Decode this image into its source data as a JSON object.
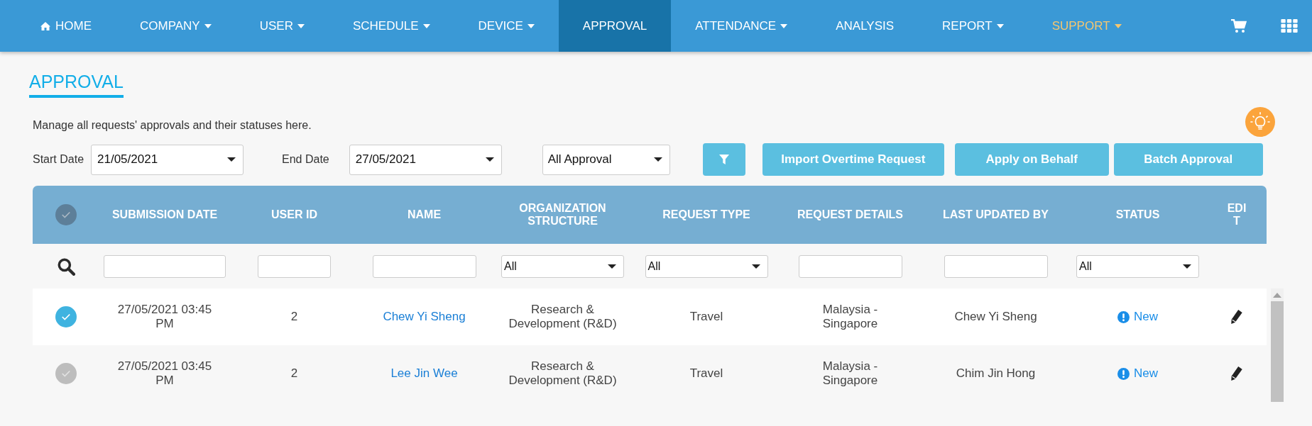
{
  "nav": {
    "items": [
      {
        "label": "HOME",
        "kind": "home",
        "selected": false,
        "highlighted": false
      },
      {
        "label": "COMPANY",
        "kind": "menu",
        "selected": false,
        "highlighted": false
      },
      {
        "label": "USER",
        "kind": "menu",
        "selected": false,
        "highlighted": false
      },
      {
        "label": "SCHEDULE",
        "kind": "menu",
        "selected": false,
        "highlighted": false
      },
      {
        "label": "DEVICE",
        "kind": "menu",
        "selected": false,
        "highlighted": false
      },
      {
        "label": "APPROVAL",
        "kind": "link",
        "selected": true,
        "highlighted": false
      },
      {
        "label": "ATTENDANCE",
        "kind": "menu",
        "selected": false,
        "highlighted": false
      },
      {
        "label": "ANALYSIS",
        "kind": "link",
        "selected": false,
        "highlighted": false
      },
      {
        "label": "REPORT",
        "kind": "menu",
        "selected": false,
        "highlighted": false
      },
      {
        "label": "SUPPORT",
        "kind": "menu",
        "selected": false,
        "highlighted": true
      }
    ]
  },
  "page": {
    "title": "APPROVAL",
    "description": "Manage all requests' approvals and their statuses here."
  },
  "filters": {
    "start_date": {
      "label": "Start Date",
      "value": "21/05/2021"
    },
    "end_date": {
      "label": "End Date",
      "value": "27/05/2021"
    },
    "approval": {
      "value": "All Approval"
    }
  },
  "buttons": [
    "Import Overtime Request",
    "Apply on Behalf",
    "Batch Approval"
  ],
  "table": {
    "select_all": {
      "checked": false
    },
    "columns": [
      {
        "label": "SUBMISSION DATE",
        "filter": {
          "kind": "text"
        }
      },
      {
        "label": "USER ID",
        "filter": {
          "kind": "text"
        }
      },
      {
        "label": "NAME",
        "filter": {
          "kind": "text"
        }
      },
      {
        "label": "ORGANIZATION STRUCTURE",
        "filter": {
          "kind": "select",
          "value": "All"
        }
      },
      {
        "label": "REQUEST TYPE",
        "filter": {
          "kind": "select",
          "value": "All"
        }
      },
      {
        "label": "REQUEST DETAILS",
        "filter": {
          "kind": "text"
        }
      },
      {
        "label": "LAST UPDATED BY",
        "filter": {
          "kind": "text"
        }
      },
      {
        "label": "STATUS",
        "filter": {
          "kind": "select",
          "value": "All"
        }
      },
      {
        "label": "EDI T",
        "filter": {
          "kind": "none"
        }
      }
    ],
    "rows": [
      {
        "selected": true,
        "submission_date": "27/05/2021 03:45 PM",
        "user_id": "2",
        "name": "Chew Yi Sheng",
        "organization": "Research & Development (R&D)",
        "request_type": "Travel",
        "request_details": "Malaysia - Singapore",
        "last_updated_by": "Chew Yi Sheng",
        "status": "New"
      },
      {
        "selected": false,
        "submission_date": "27/05/2021 03:45 PM",
        "user_id": "2",
        "name": "Lee Jin Wee",
        "organization": "Research & Development (R&D)",
        "request_type": "Travel",
        "request_details": "Malaysia - Singapore",
        "last_updated_by": "Chim Jin Hong",
        "status": "New"
      }
    ]
  }
}
